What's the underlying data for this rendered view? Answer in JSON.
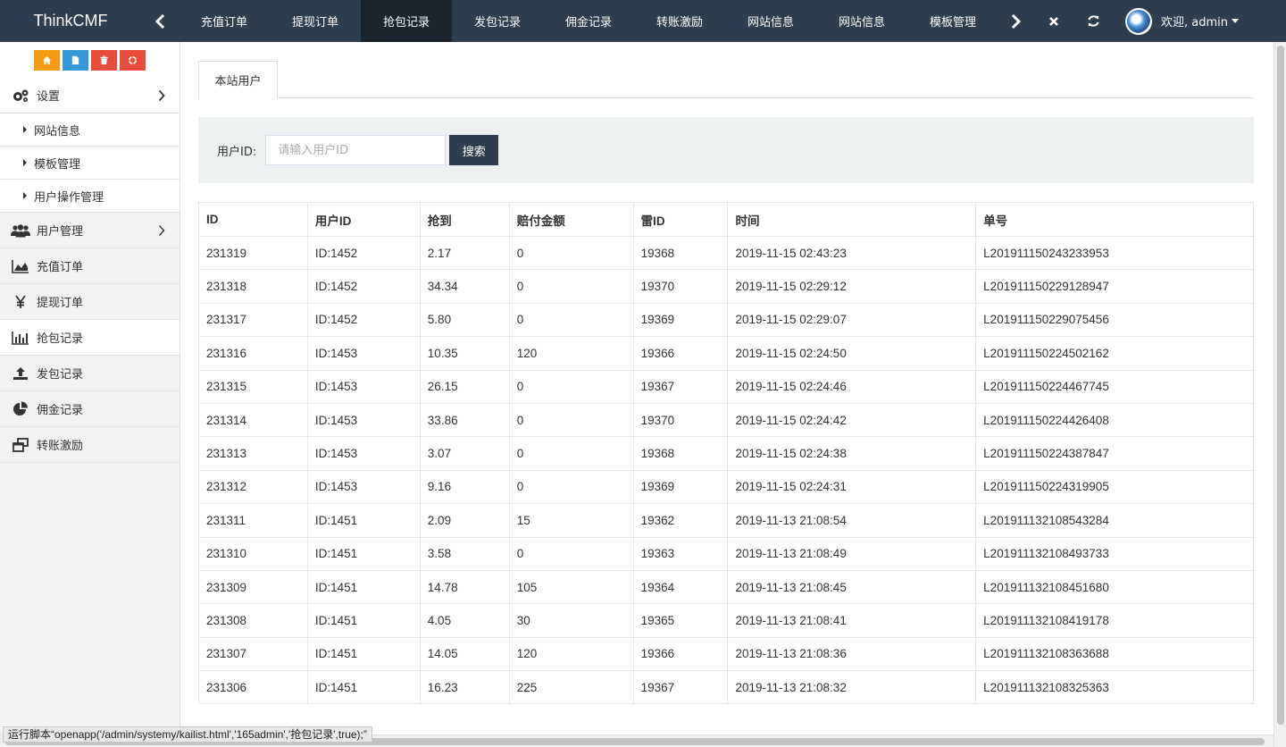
{
  "brand": "ThinkCMF",
  "top_tabs": [
    {
      "label": "充值订单"
    },
    {
      "label": "提现订单"
    },
    {
      "label": "抢包记录",
      "active": true
    },
    {
      "label": "发包记录"
    },
    {
      "label": "佣金记录"
    },
    {
      "label": "转账激励"
    },
    {
      "label": "网站信息"
    },
    {
      "label": "网站信息"
    },
    {
      "label": "模板管理"
    }
  ],
  "user": {
    "greeting": "欢迎, admin"
  },
  "colors": {
    "topbar": "#2c3e50",
    "active_tab": "#1a252f",
    "sc_home": "#f39c12",
    "sc_doc": "#3498db",
    "sc_trash": "#e74c3c",
    "sc_recycle": "#e74c3c"
  },
  "sidebar": {
    "settings": {
      "label": "设置",
      "icon": "gears-icon"
    },
    "settings_sub": [
      {
        "label": "网站信息"
      },
      {
        "label": "模板管理"
      },
      {
        "label": "用户操作管理"
      }
    ],
    "items": [
      {
        "label": "用户管理",
        "icon": "users-icon"
      },
      {
        "label": "充值订单",
        "icon": "area-chart-icon"
      },
      {
        "label": "提现订单",
        "icon": "yen-icon"
      },
      {
        "label": "抢包记录",
        "icon": "bar-chart-icon",
        "active": true
      },
      {
        "label": "发包记录",
        "icon": "upload-icon"
      },
      {
        "label": "佣金记录",
        "icon": "pie-chart-icon"
      },
      {
        "label": "转账激励",
        "icon": "windows-icon"
      }
    ]
  },
  "page_tab": "本站用户",
  "search": {
    "label": "用户ID:",
    "placeholder": "请输入用户ID",
    "button": "搜索"
  },
  "table": {
    "headers": [
      "ID",
      "用户ID",
      "抢到",
      "赔付金额",
      "雷ID",
      "时间",
      "单号"
    ],
    "rows": [
      [
        "231319",
        "ID:1452",
        "2.17",
        "0",
        "19368",
        "2019-11-15 02:43:23",
        "L201911150243233953"
      ],
      [
        "231318",
        "ID:1452",
        "34.34",
        "0",
        "19370",
        "2019-11-15 02:29:12",
        "L201911150229128947"
      ],
      [
        "231317",
        "ID:1452",
        "5.80",
        "0",
        "19369",
        "2019-11-15 02:29:07",
        "L201911150229075456"
      ],
      [
        "231316",
        "ID:1453",
        "10.35",
        "120",
        "19366",
        "2019-11-15 02:24:50",
        "L201911150224502162"
      ],
      [
        "231315",
        "ID:1453",
        "26.15",
        "0",
        "19367",
        "2019-11-15 02:24:46",
        "L201911150224467745"
      ],
      [
        "231314",
        "ID:1453",
        "33.86",
        "0",
        "19370",
        "2019-11-15 02:24:42",
        "L201911150224426408"
      ],
      [
        "231313",
        "ID:1453",
        "3.07",
        "0",
        "19368",
        "2019-11-15 02:24:38",
        "L201911150224387847"
      ],
      [
        "231312",
        "ID:1453",
        "9.16",
        "0",
        "19369",
        "2019-11-15 02:24:31",
        "L201911150224319905"
      ],
      [
        "231311",
        "ID:1451",
        "2.09",
        "15",
        "19362",
        "2019-11-13 21:08:54",
        "L201911132108543284"
      ],
      [
        "231310",
        "ID:1451",
        "3.58",
        "0",
        "19363",
        "2019-11-13 21:08:49",
        "L201911132108493733"
      ],
      [
        "231309",
        "ID:1451",
        "14.78",
        "105",
        "19364",
        "2019-11-13 21:08:45",
        "L201911132108451680"
      ],
      [
        "231308",
        "ID:1451",
        "4.05",
        "30",
        "19365",
        "2019-11-13 21:08:41",
        "L201911132108419178"
      ],
      [
        "231307",
        "ID:1451",
        "14.05",
        "120",
        "19366",
        "2019-11-13 21:08:36",
        "L201911132108363688"
      ],
      [
        "231306",
        "ID:1451",
        "16.23",
        "225",
        "19367",
        "2019-11-13 21:08:32",
        "L201911132108325363"
      ]
    ]
  },
  "status_bar": "运行脚本“openapp('/admin/systemy/kailist.html','165admin','抢包记录',true);”"
}
